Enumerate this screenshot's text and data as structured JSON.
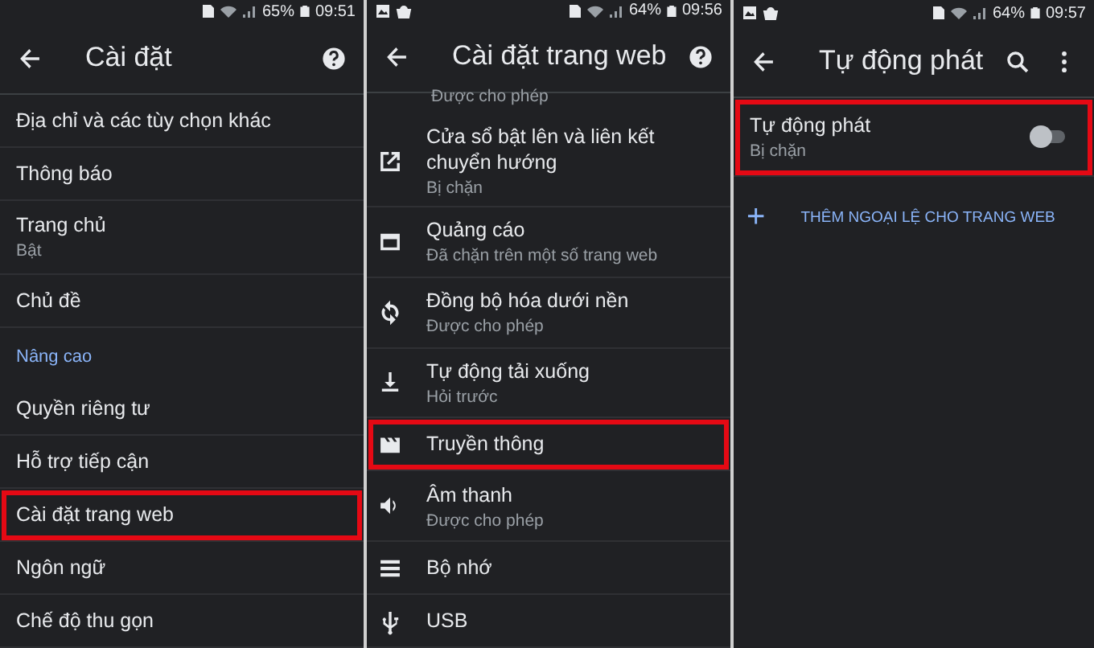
{
  "panels": [
    {
      "status_bar": {
        "notifications": false,
        "battery": "65%",
        "time": "09:51"
      },
      "title": "Cài đặt",
      "actions": [
        {
          "kind": "help"
        }
      ],
      "items": [
        {
          "kind": "text",
          "title": "Địa chỉ và các tùy chọn khác",
          "highlighted": false
        },
        {
          "kind": "text",
          "title": "Thông báo",
          "highlighted": false
        },
        {
          "kind": "text",
          "title": "Trang chủ",
          "subtitle": "Bật",
          "highlighted": false
        },
        {
          "kind": "text",
          "title": "Chủ đề",
          "highlighted": false
        },
        {
          "kind": "header",
          "title": "Nâng cao"
        },
        {
          "kind": "text",
          "title": "Quyền riêng tư",
          "highlighted": false
        },
        {
          "kind": "text",
          "title": "Hỗ trợ tiếp cận",
          "highlighted": false
        },
        {
          "kind": "text",
          "title": "Cài đặt trang web",
          "highlighted": true
        },
        {
          "kind": "text",
          "title": "Ngôn ngữ",
          "highlighted": false
        },
        {
          "kind": "text",
          "title": "Chế độ thu gọn",
          "highlighted": false
        }
      ]
    },
    {
      "status_bar": {
        "notifications": true,
        "battery": "64%",
        "time": "09:56"
      },
      "title": "Cài đặt trang web",
      "actions": [
        {
          "kind": "help"
        }
      ],
      "items": [
        {
          "kind": "partial",
          "subtitle": "Được cho phép"
        },
        {
          "kind": "popup",
          "title": "Cửa sổ bật lên và liên kết chuyển hướng",
          "subtitle": "Bị chặn",
          "highlighted": false
        },
        {
          "kind": "ads",
          "title": "Quảng cáo",
          "subtitle": "Đã chặn trên một số trang web",
          "highlighted": false
        },
        {
          "kind": "sync",
          "title": "Đồng bộ hóa dưới nền",
          "subtitle": "Được cho phép",
          "highlighted": false
        },
        {
          "kind": "download",
          "title": "Tự động tải xuống",
          "subtitle": "Hỏi trước",
          "highlighted": false
        },
        {
          "kind": "media",
          "title": "Truyền thông",
          "highlighted": true
        },
        {
          "kind": "sound",
          "title": "Âm thanh",
          "subtitle": "Được cho phép",
          "highlighted": false
        },
        {
          "kind": "storage",
          "title": "Bộ nhớ",
          "highlighted": false
        },
        {
          "kind": "usb",
          "title": "USB",
          "highlighted": false
        }
      ]
    },
    {
      "status_bar": {
        "notifications": true,
        "battery": "64%",
        "time": "09:57"
      },
      "title": "Tự động phát",
      "actions": [
        {
          "kind": "search"
        },
        {
          "kind": "more"
        }
      ],
      "items": [
        {
          "kind": "toggle",
          "title": "Tự động phát",
          "subtitle": "Bị chặn",
          "on": false,
          "highlighted": true
        },
        {
          "kind": "add",
          "icon_text": "+",
          "title": "THÊM NGOẠI LỆ CHO TRANG WEB"
        }
      ]
    }
  ]
}
